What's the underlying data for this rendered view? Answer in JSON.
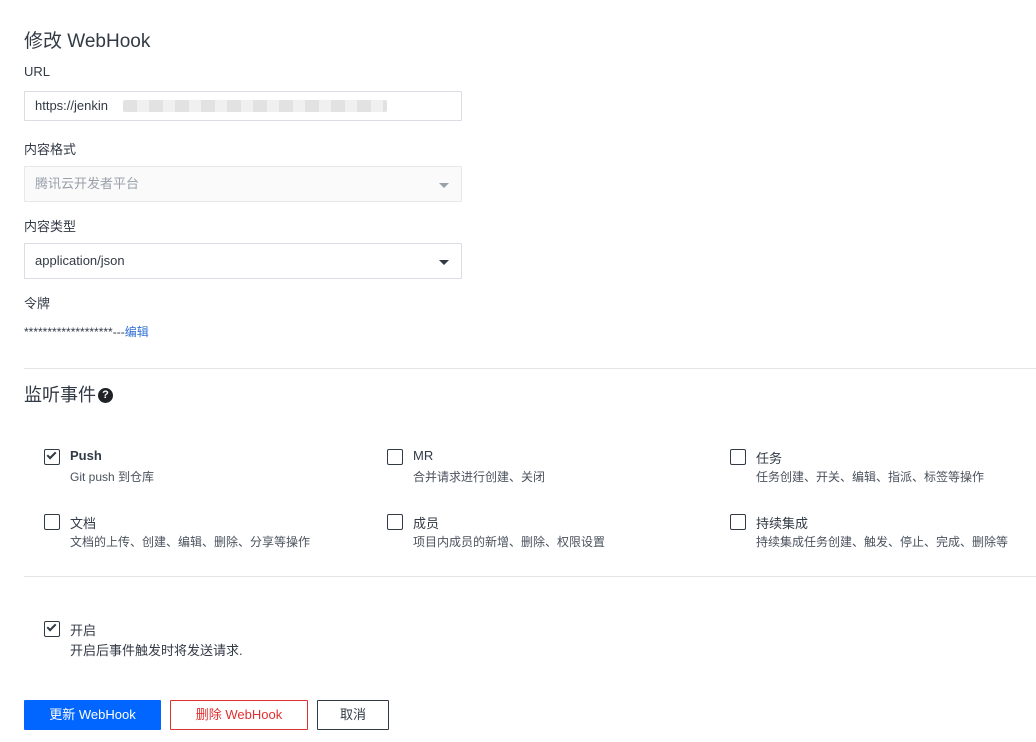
{
  "page_title": "修改 WebHook",
  "url_field": {
    "label": "URL",
    "value": "https://jenkin"
  },
  "content_format": {
    "label": "内容格式",
    "value": "腾讯云开发者平台"
  },
  "content_type": {
    "label": "内容类型",
    "value": "application/json"
  },
  "token": {
    "label": "令牌",
    "masked": "*******************---",
    "edit_label": "编辑"
  },
  "events": {
    "title": "监听事件",
    "help_icon": "?",
    "items": [
      {
        "name": "Push",
        "desc": "Git push 到仓库",
        "checked": true
      },
      {
        "name": "MR",
        "desc": "合并请求进行创建、关闭",
        "checked": false
      },
      {
        "name": "任务",
        "desc": "任务创建、开关、编辑、指派、标签等操作",
        "checked": false
      },
      {
        "name": "文档",
        "desc": "文档的上传、创建、编辑、删除、分享等操作",
        "checked": false
      },
      {
        "name": "成员",
        "desc": "项目内成员的新增、删除、权限设置",
        "checked": false
      },
      {
        "name": "持续集成",
        "desc": "持续集成任务创建、触发、停止、完成、删除等",
        "checked": false
      }
    ]
  },
  "enable": {
    "label": "开启",
    "desc": "开启后事件触发时将发送请求.",
    "checked": true
  },
  "buttons": {
    "update": "更新 WebHook",
    "delete": "删除 WebHook",
    "cancel": "取消"
  },
  "colors": {
    "primary": "#0066ff",
    "danger": "#e03131",
    "link": "#2f6fd6"
  }
}
